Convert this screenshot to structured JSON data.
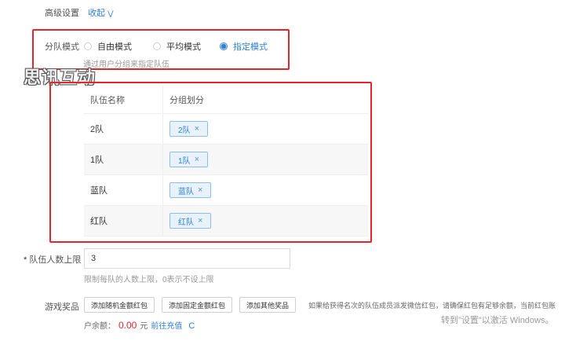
{
  "advanced": {
    "title": "高级设置",
    "collapse_label": "收起"
  },
  "grouping": {
    "label": "分队模式",
    "options": [
      "自由模式",
      "平均模式",
      "指定模式"
    ],
    "selected": "指定模式",
    "hint": "通过用户分组来指定队伍"
  },
  "watermark": "思讯互动",
  "teams_table": {
    "headers": [
      "队伍名称",
      "分组划分"
    ],
    "rows": [
      {
        "name": "2队",
        "tag": "2队"
      },
      {
        "name": "1队",
        "tag": "1队"
      },
      {
        "name": "蓝队",
        "tag": "蓝队"
      },
      {
        "name": "红队",
        "tag": "红队"
      }
    ]
  },
  "team_limit": {
    "required_mark": "*",
    "label": "队伍人数上限",
    "value": "3",
    "hint": "限制每队的人数上限，0表示不设上限"
  },
  "prizes": {
    "label": "游戏奖品",
    "buttons": [
      "添加随机金额红包",
      "添加固定金额红包",
      "添加其他奖品"
    ],
    "note": "如果给获得名次的队伍成员派发微信红包，请确保红包有足够余额，当前红包账",
    "balance_prefix": "户余额：",
    "balance_amount": "0.00",
    "balance_unit": "元",
    "recharge_label": "前往充值",
    "refresh_icon": "C"
  },
  "activation": "转到\"设置\"以激活 Windows。",
  "colors": {
    "accent": "#2f7fd8",
    "highlight_box": "#e2262e",
    "balance": "#e2262e"
  }
}
